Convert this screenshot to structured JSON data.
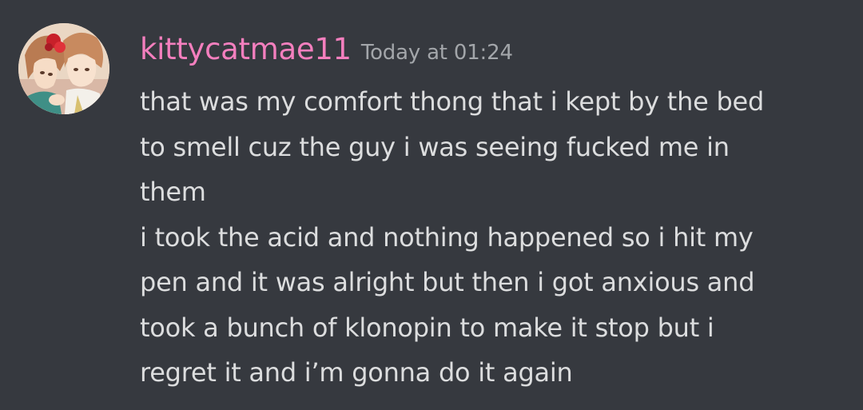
{
  "message": {
    "author": {
      "username": "kittycatmae11",
      "name_color": "#f47fbe",
      "avatar_icon": "anime-avatar-icon"
    },
    "timestamp": "Today at 01:24",
    "lines": [
      "that was my comfort thong that i kept by the bed",
      "to smell cuz the guy i was seeing fucked me in",
      "them",
      "i took the acid and nothing happened so i hit my",
      "pen and it was alright but then i got anxious and",
      "took a bunch of klonopin to make it stop but i",
      "regret it and i’m gonna do it again"
    ]
  },
  "theme": {
    "background": "#36393f",
    "text": "#dcddde",
    "muted": "#a3a6aa"
  }
}
